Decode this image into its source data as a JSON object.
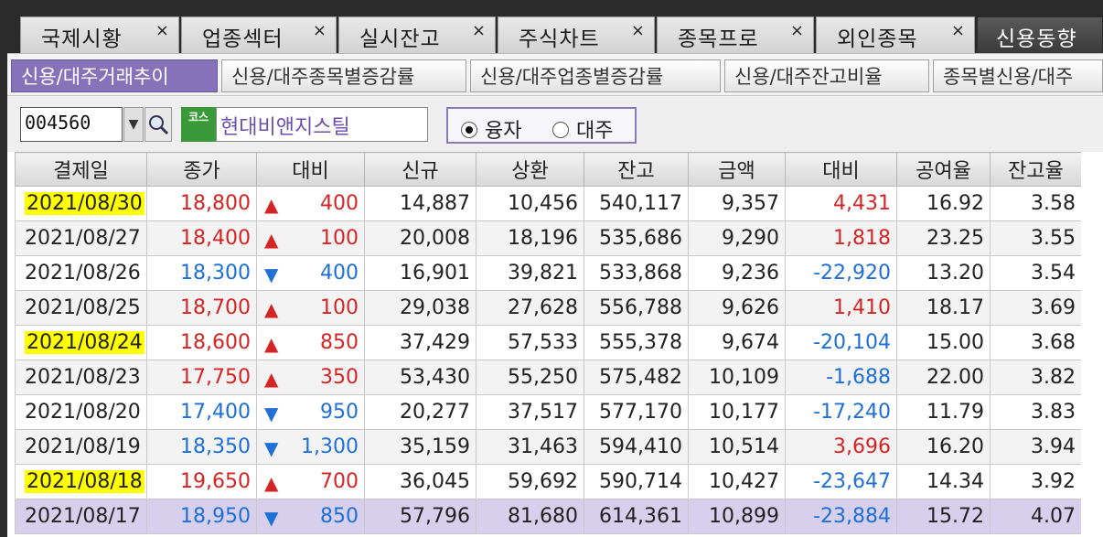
{
  "top_tabs": [
    {
      "label": "국제시황",
      "close": "×"
    },
    {
      "label": "업종섹터",
      "close": "×"
    },
    {
      "label": "실시잔고",
      "close": "×"
    },
    {
      "label": "주식차트",
      "close": "×"
    },
    {
      "label": "종목프로",
      "close": "×"
    },
    {
      "label": "외인종목",
      "close": "×"
    },
    {
      "label": "신용동향",
      "close": ""
    }
  ],
  "sub_tabs": [
    {
      "label": "신용/대주거래추이"
    },
    {
      "label": "신용/대주종목별증감률"
    },
    {
      "label": "신용/대주업종별증감률"
    },
    {
      "label": "신용/대주잔고비율"
    },
    {
      "label": "종목별신용/대주"
    }
  ],
  "search": {
    "code": "004560",
    "dropdown": "▼",
    "market_badge": "코스",
    "stock_name": "현대비앤지스틸",
    "radio": [
      {
        "label": "융자",
        "selected": true
      },
      {
        "label": "대주",
        "selected": false
      }
    ]
  },
  "table": {
    "headers": [
      "결제일",
      "종가",
      "대비",
      "신규",
      "상환",
      "잔고",
      "금액",
      "대비",
      "공여율",
      "잔고율"
    ],
    "rows": [
      {
        "date": "2021/08/30",
        "close": "18,800",
        "dir": "up",
        "chg": "400",
        "new": "14,887",
        "repay": "10,456",
        "bal": "540,117",
        "amt": "9,357",
        "amt_chg": "4,431",
        "rate": "16.92",
        "bal_rate": "3.58",
        "hl": true
      },
      {
        "date": "2021/08/27",
        "close": "18,400",
        "dir": "up",
        "chg": "100",
        "new": "20,008",
        "repay": "18,196",
        "bal": "535,686",
        "amt": "9,290",
        "amt_chg": "1,818",
        "rate": "23.25",
        "bal_rate": "3.55",
        "hl": false
      },
      {
        "date": "2021/08/26",
        "close": "18,300",
        "dir": "down",
        "chg": "400",
        "new": "16,901",
        "repay": "39,821",
        "bal": "533,868",
        "amt": "9,236",
        "amt_chg": "-22,920",
        "rate": "13.20",
        "bal_rate": "3.54",
        "hl": false
      },
      {
        "date": "2021/08/25",
        "close": "18,700",
        "dir": "up",
        "chg": "100",
        "new": "29,038",
        "repay": "27,628",
        "bal": "556,788",
        "amt": "9,626",
        "amt_chg": "1,410",
        "rate": "18.17",
        "bal_rate": "3.69",
        "hl": false
      },
      {
        "date": "2021/08/24",
        "close": "18,600",
        "dir": "up",
        "chg": "850",
        "new": "37,429",
        "repay": "57,533",
        "bal": "555,378",
        "amt": "9,674",
        "amt_chg": "-20,104",
        "rate": "15.00",
        "bal_rate": "3.68",
        "hl": true
      },
      {
        "date": "2021/08/23",
        "close": "17,750",
        "dir": "up",
        "chg": "350",
        "new": "53,430",
        "repay": "55,250",
        "bal": "575,482",
        "amt": "10,109",
        "amt_chg": "-1,688",
        "rate": "22.00",
        "bal_rate": "3.82",
        "hl": false
      },
      {
        "date": "2021/08/20",
        "close": "17,400",
        "dir": "down",
        "chg": "950",
        "new": "20,277",
        "repay": "37,517",
        "bal": "577,170",
        "amt": "10,177",
        "amt_chg": "-17,240",
        "rate": "11.79",
        "bal_rate": "3.83",
        "hl": false
      },
      {
        "date": "2021/08/19",
        "close": "18,350",
        "dir": "down",
        "chg": "1,300",
        "new": "35,159",
        "repay": "31,463",
        "bal": "594,410",
        "amt": "10,514",
        "amt_chg": "3,696",
        "rate": "16.20",
        "bal_rate": "3.94",
        "hl": false
      },
      {
        "date": "2021/08/18",
        "close": "19,650",
        "dir": "up",
        "chg": "700",
        "new": "36,045",
        "repay": "59,692",
        "bal": "590,714",
        "amt": "10,427",
        "amt_chg": "-23,647",
        "rate": "14.34",
        "bal_rate": "3.92",
        "hl": true
      },
      {
        "date": "2021/08/17",
        "close": "18,950",
        "dir": "down",
        "chg": "850",
        "new": "57,796",
        "repay": "81,680",
        "bal": "614,361",
        "amt": "10,899",
        "amt_chg": "-23,884",
        "rate": "15.72",
        "bal_rate": "4.07",
        "hl": false,
        "selected": true
      }
    ]
  },
  "colors": {
    "up": "#d42424",
    "down": "#1e6fd6",
    "highlight": "#ffff00",
    "active_tab": "#8672b8"
  },
  "icons": {
    "search": "magnifier-icon",
    "dropdown": "chevron-down-icon",
    "up": "▲",
    "down": "▼"
  }
}
